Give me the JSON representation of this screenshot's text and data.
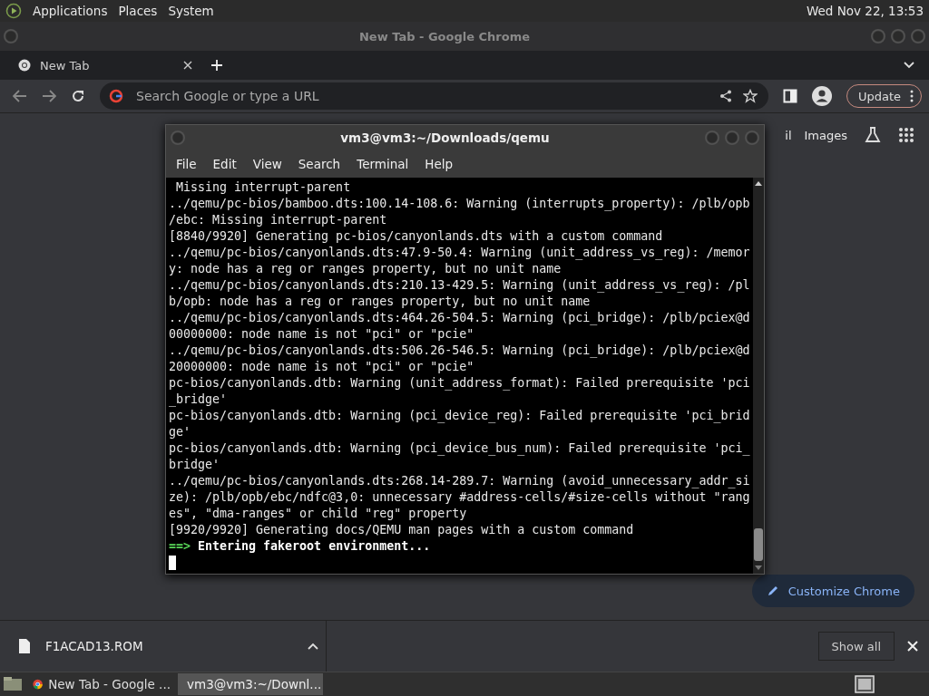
{
  "top_panel": {
    "menus": [
      "Applications",
      "Places",
      "System"
    ],
    "clock": "Wed Nov 22, 13:53"
  },
  "chrome": {
    "window_title": "New Tab - Google Chrome",
    "tabs": [
      {
        "label": "New Tab",
        "selected": true
      }
    ],
    "address_placeholder": "Search Google or type a URL",
    "update_button": "Update",
    "ntp_links": [
      "il",
      "Images"
    ],
    "customize_button": "Customize Chrome",
    "download": {
      "filename": "F1ACAD13.ROM"
    },
    "show_all": "Show all"
  },
  "terminal": {
    "title": "vm3@vm3:~/Downloads/qemu",
    "menus": [
      "File",
      "Edit",
      "View",
      "Search",
      "Terminal",
      "Help"
    ],
    "lines": [
      {
        "kind": "output",
        "text": " Missing interrupt-parent"
      },
      {
        "kind": "output",
        "text": "../qemu/pc-bios/bamboo.dts:100.14-108.6: Warning (interrupts_property): /plb/opb"
      },
      {
        "kind": "output",
        "text": "/ebc: Missing interrupt-parent"
      },
      {
        "kind": "output",
        "text": "[8840/9920] Generating pc-bios/canyonlands.dts with a custom command"
      },
      {
        "kind": "output",
        "text": "../qemu/pc-bios/canyonlands.dts:47.9-50.4: Warning (unit_address_vs_reg): /memor"
      },
      {
        "kind": "output",
        "text": "y: node has a reg or ranges property, but no unit name"
      },
      {
        "kind": "output",
        "text": "../qemu/pc-bios/canyonlands.dts:210.13-429.5: Warning (unit_address_vs_reg): /pl"
      },
      {
        "kind": "output",
        "text": "b/opb: node has a reg or ranges property, but no unit name"
      },
      {
        "kind": "output",
        "text": "../qemu/pc-bios/canyonlands.dts:464.26-504.5: Warning (pci_bridge): /plb/pciex@d"
      },
      {
        "kind": "output",
        "text": "00000000: node name is not \"pci\" or \"pcie\""
      },
      {
        "kind": "output",
        "text": "../qemu/pc-bios/canyonlands.dts:506.26-546.5: Warning (pci_bridge): /plb/pciex@d"
      },
      {
        "kind": "output",
        "text": "20000000: node name is not \"pci\" or \"pcie\""
      },
      {
        "kind": "output",
        "text": "pc-bios/canyonlands.dtb: Warning (unit_address_format): Failed prerequisite 'pci"
      },
      {
        "kind": "output",
        "text": "_bridge'"
      },
      {
        "kind": "output",
        "text": "pc-bios/canyonlands.dtb: Warning (pci_device_reg): Failed prerequisite 'pci_brid"
      },
      {
        "kind": "output",
        "text": "ge'"
      },
      {
        "kind": "output",
        "text": "pc-bios/canyonlands.dtb: Warning (pci_device_bus_num): Failed prerequisite 'pci_"
      },
      {
        "kind": "output",
        "text": "bridge'"
      },
      {
        "kind": "output",
        "text": "../qemu/pc-bios/canyonlands.dts:268.14-289.7: Warning (avoid_unnecessary_addr_si"
      },
      {
        "kind": "output",
        "text": "ze): /plb/opb/ebc/ndfc@3,0: unnecessary #address-cells/#size-cells without \"rang"
      },
      {
        "kind": "output",
        "text": "es\", \"dma-ranges\" or child \"reg\" property"
      },
      {
        "kind": "output",
        "text": "[9920/9920] Generating docs/QEMU man pages with a custom command"
      },
      {
        "kind": "status",
        "arrow": "==>",
        "text": "Entering fakeroot environment..."
      },
      {
        "kind": "cursor"
      }
    ]
  },
  "taskbar": {
    "items": [
      {
        "label": "New Tab - Google ...",
        "kind": "browser",
        "selected": false
      },
      {
        "label": "vm3@vm3:~/Downl...",
        "kind": "terminal",
        "selected": true
      }
    ]
  }
}
